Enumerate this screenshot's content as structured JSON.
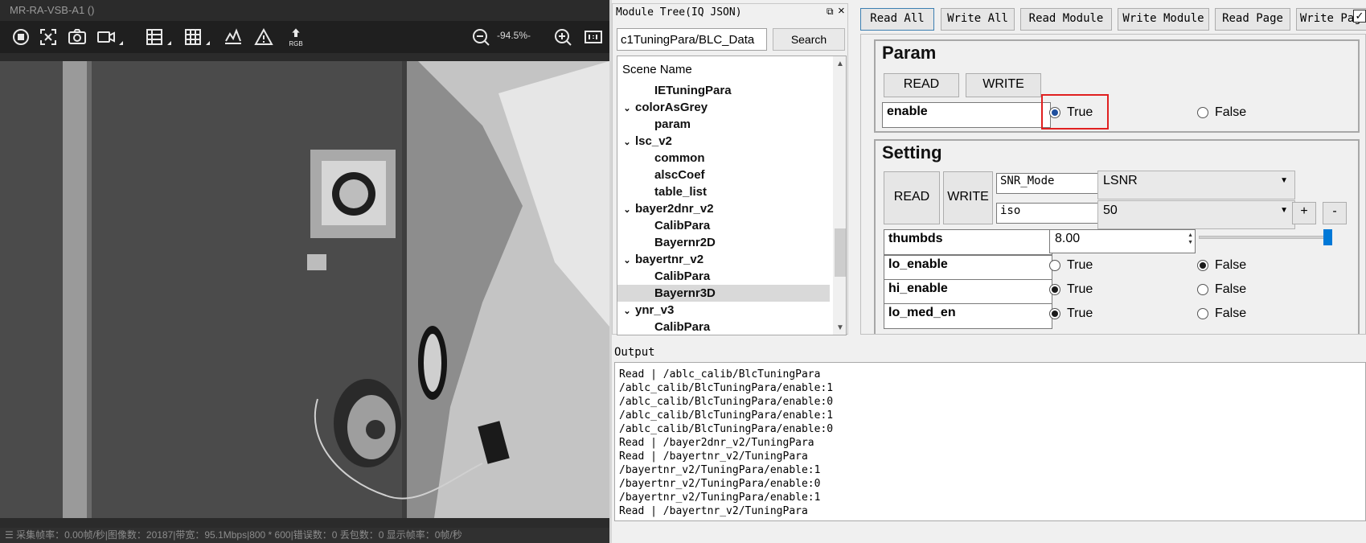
{
  "viewer": {
    "title": "MR-RA-VSB-A1 ()",
    "zoom": "-94.5%-",
    "toolbar_icons": [
      "stop-icon",
      "fit-screen-icon",
      "camera-icon",
      "video-icon",
      "grid-icon",
      "grid-large-icon",
      "histogram-icon",
      "warning-icon",
      "rgb-upload-icon",
      "zoom-out-icon",
      "zoom-in-icon",
      "original-size-icon"
    ],
    "rgb_label": "RGB",
    "status": "☰ 采集帧率：0.00帧/秒|图像数：20187|带宽：95.1Mbps|800 * 600|错误数：0 丢包数：0 显示帧率：0帧/秒"
  },
  "module_tree": {
    "title": "Module Tree(IQ JSON)",
    "float_icon": "⧉",
    "close_icon": "×",
    "path_value": "c1TuningPara/BLC_Data",
    "search_label": "Search",
    "header": "Scene Name",
    "items": [
      {
        "label": "IETuningPara",
        "level": 1,
        "expanded": null,
        "selected": false
      },
      {
        "label": "colorAsGrey",
        "level": 0,
        "expanded": true,
        "selected": false
      },
      {
        "label": "param",
        "level": 1,
        "expanded": null,
        "selected": false
      },
      {
        "label": "lsc_v2",
        "level": 0,
        "expanded": true,
        "selected": false
      },
      {
        "label": "common",
        "level": 1,
        "expanded": null,
        "selected": false
      },
      {
        "label": "alscCoef",
        "level": 1,
        "expanded": null,
        "selected": false
      },
      {
        "label": "table_list",
        "level": 1,
        "expanded": null,
        "selected": false
      },
      {
        "label": "bayer2dnr_v2",
        "level": 0,
        "expanded": true,
        "selected": false
      },
      {
        "label": "CalibPara",
        "level": 1,
        "expanded": null,
        "selected": false
      },
      {
        "label": "Bayernr2D",
        "level": 1,
        "expanded": null,
        "selected": false
      },
      {
        "label": "bayertnr_v2",
        "level": 0,
        "expanded": true,
        "selected": false
      },
      {
        "label": "CalibPara",
        "level": 1,
        "expanded": null,
        "selected": false
      },
      {
        "label": "Bayernr3D",
        "level": 1,
        "expanded": null,
        "selected": true
      },
      {
        "label": "ynr_v3",
        "level": 0,
        "expanded": true,
        "selected": false
      },
      {
        "label": "CalibPara",
        "level": 1,
        "expanded": null,
        "selected": false
      }
    ]
  },
  "top_buttons": [
    "Read All",
    "Write All",
    "Read Module",
    "Write Module",
    "Read Page",
    "Write Page"
  ],
  "top_checkbox": "✓",
  "param": {
    "title": "Param",
    "read_label": "READ",
    "write_label": "WRITE",
    "enable_field": "enable",
    "true_label": "True",
    "false_label": "False",
    "enable_value": true
  },
  "setting": {
    "title": "Setting",
    "read_label": "READ",
    "write_label": "WRITE",
    "snr_mode_label": "SNR_Mode",
    "snr_mode_value": "LSNR",
    "iso_label": "iso",
    "iso_value": "50",
    "plus_label": "+",
    "minus_label": "-",
    "thumbds_label": "thumbds",
    "thumbds_value": "8.00",
    "thumbds_slider_fraction": 1.0,
    "rows": [
      {
        "name": "lo_enable",
        "value": false
      },
      {
        "name": "hi_enable",
        "value": true
      },
      {
        "name": "lo_med_en",
        "value": true
      }
    ],
    "true_label": "True",
    "false_label": "False"
  },
  "output": {
    "title": "Output",
    "lines": [
      "Read | /ablc_calib/BlcTuningPara",
      "/ablc_calib/BlcTuningPara/enable:1",
      "/ablc_calib/BlcTuningPara/enable:0",
      "/ablc_calib/BlcTuningPara/enable:1",
      "/ablc_calib/BlcTuningPara/enable:0",
      "Read | /bayer2dnr_v2/TuningPara",
      "Read | /bayertnr_v2/TuningPara",
      "/bayertnr_v2/TuningPara/enable:1",
      "/bayertnr_v2/TuningPara/enable:0",
      "/bayertnr_v2/TuningPara/enable:1",
      "Read | /bayertnr_v2/TuningPara"
    ]
  },
  "colors": {
    "highlight_box": "#e02020",
    "slider_accent": "#0078d7"
  }
}
